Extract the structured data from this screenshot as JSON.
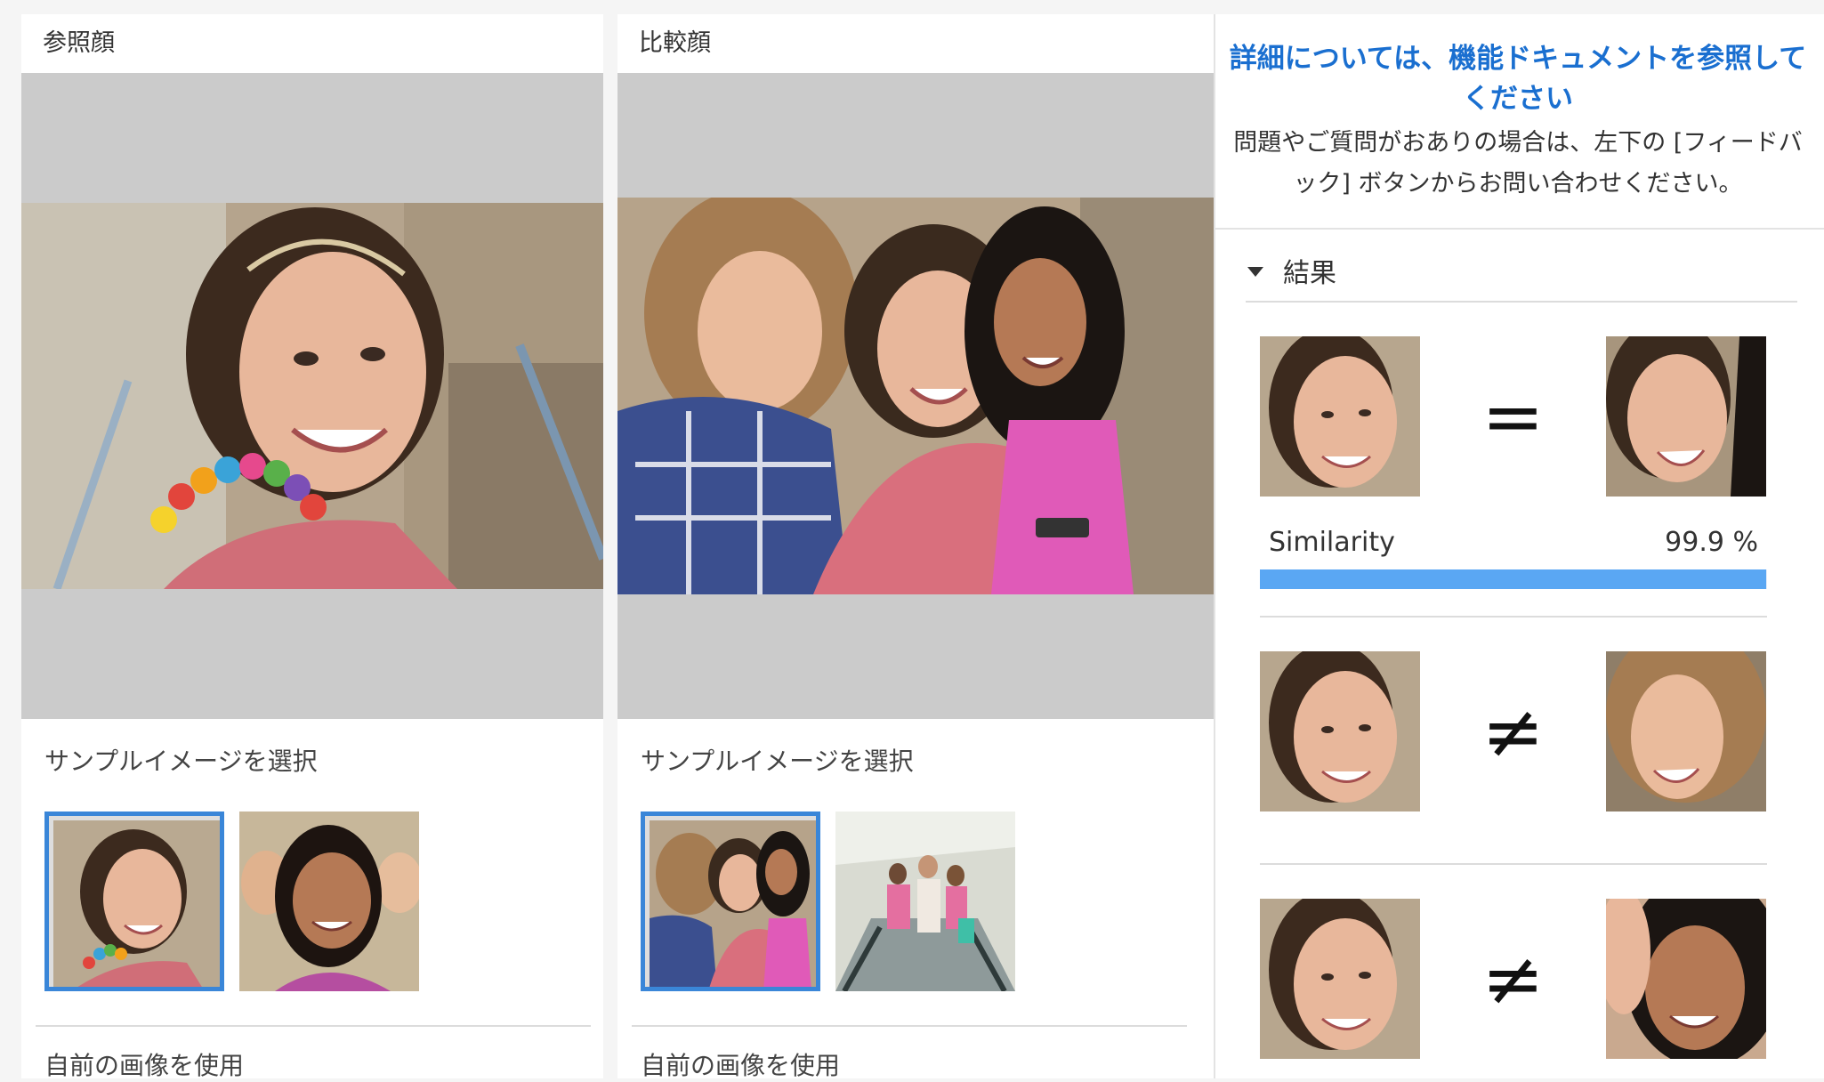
{
  "reference": {
    "header": "参照顔",
    "sample_title": "サンプルイメージを選択",
    "own_image_title": "自前の画像を使用"
  },
  "comparison": {
    "header": "比較顔",
    "sample_title": "サンプルイメージを選択",
    "own_image_title": "自前の画像を使用"
  },
  "panel": {
    "doc_link": "詳細については、機能ドキュメントを参照してください",
    "help_text": "問題やご質問がおありの場合は、左下の [フィードバック] ボタンからお問い合わせください。",
    "results_title": "結果",
    "results": [
      {
        "relation": "=",
        "similarity_label": "Similarity",
        "similarity_value": "99.9 %",
        "similarity_fraction": 0.999
      },
      {
        "relation": "≠"
      },
      {
        "relation": "≠"
      }
    ]
  },
  "colors": {
    "accent": "#1a6fd0",
    "selected_border": "#3a86d8",
    "similarity_bar": "#5aa7f3",
    "stage_bg": "#cbcbcb"
  }
}
